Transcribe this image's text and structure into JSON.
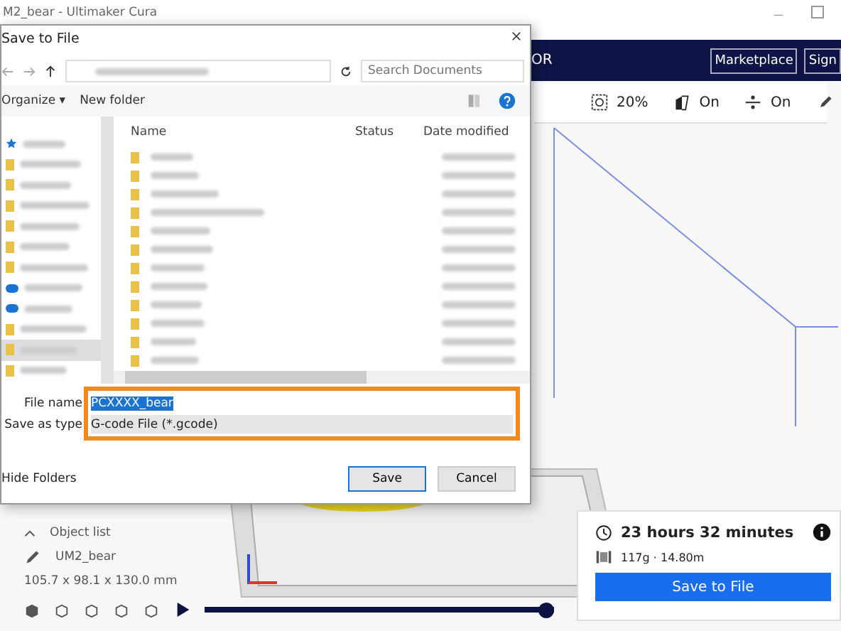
{
  "window": {
    "title": "M2_bear - Ultimaker Cura"
  },
  "header": {
    "stage_label": "OR",
    "buttons": [
      "Marketplace",
      "Sign"
    ]
  },
  "print_settings": [
    {
      "kind": "infill",
      "value": "20%"
    },
    {
      "kind": "support",
      "value": "On"
    },
    {
      "kind": "adhesion",
      "value": "On"
    }
  ],
  "dialog": {
    "title": "Save to File",
    "search": {
      "placeholder": "Search Documents"
    },
    "toolbar": [
      "Organize ▾",
      "New folder"
    ],
    "columns": [
      "Name",
      "Status",
      "Date modified"
    ],
    "nav_items": [
      {
        "kind": "star",
        "selected": false
      },
      {
        "kind": "folder",
        "selected": false
      },
      {
        "kind": "folder",
        "selected": false
      },
      {
        "kind": "folder",
        "selected": false
      },
      {
        "kind": "folder",
        "selected": false
      },
      {
        "kind": "folder",
        "selected": false
      },
      {
        "kind": "folder",
        "selected": false
      },
      {
        "kind": "cloud",
        "selected": false
      },
      {
        "kind": "cloud",
        "selected": false
      },
      {
        "kind": "folder",
        "selected": false
      },
      {
        "kind": "folder",
        "selected": true
      },
      {
        "kind": "folder",
        "selected": false
      }
    ],
    "file_name": "PCXXXX_bear",
    "save_as_type": "G-code File (*.gcode)",
    "file_name_label": "File name",
    "save_as_type_label": "Save as type",
    "hide_folders": "Hide Folders",
    "buttons": [
      "Save",
      "Cancel"
    ]
  },
  "object_list": {
    "label": "Object list",
    "object": "UM2_bear",
    "dimensions": "105.7 x 98.1 x 130.0 mm"
  },
  "timeline": {
    "level": 1
  },
  "print_summary": {
    "time": "23 hours 32 minutes",
    "material": "117g · 14.80m",
    "button": "Save to File"
  }
}
